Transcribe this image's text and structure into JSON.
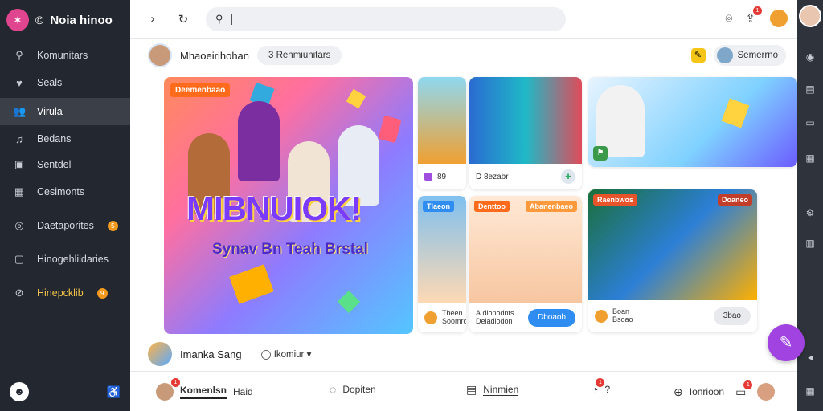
{
  "brand": {
    "name": "Noia hinoo",
    "logo_icon": "star-logo-icon"
  },
  "sidebar": {
    "items": [
      {
        "label": "Komunitars",
        "icon": "person-icon"
      },
      {
        "label": "Seals",
        "icon": "heart-icon"
      },
      {
        "label": "Virula",
        "icon": "people-icon",
        "active": true
      },
      {
        "label": "Bedans",
        "icon": "music-icon"
      },
      {
        "label": "Sentdel",
        "icon": "square-icon"
      },
      {
        "label": "Cesimonts",
        "icon": "grid-icon"
      },
      {
        "label": "Daetaporites",
        "icon": "globe-icon",
        "badge": "5"
      },
      {
        "label": "Hinogehlildaries",
        "icon": "box-icon"
      },
      {
        "label": "Hinepcklib",
        "icon": "compass-icon",
        "badge": "9",
        "highlight": true
      }
    ]
  },
  "topbar": {
    "search_placeholder": "",
    "notif_badge": "1"
  },
  "subheader": {
    "title": "Mhaoeirihohan",
    "pill": "3 Renmiunitars",
    "right_pill": "Semerrno"
  },
  "hero": {
    "tag": "Deemenbaao",
    "title": "MIBNUIOK!",
    "subtitle": "Synav Bn Teah Brstal"
  },
  "cards": [
    {
      "foot_text": "89",
      "foot_text2": "D 8ezabr"
    },
    {
      "tag": "Tlaeon"
    },
    {
      "tag": "Denttoo",
      "foot_text": "Tbeen",
      "foot_text2": "Soomro"
    },
    {
      "tag": "Abanenbaeo",
      "foot_text": "A.dlonodnts",
      "foot_text2": "Deladlodon",
      "button": "Dboaob"
    },
    {
      "tag": "Raenbwos",
      "foot_text": "Boan",
      "foot_text2": "Bsoao",
      "button": "3bao"
    },
    {
      "tag": "Doaneo"
    }
  ],
  "post": {
    "name": "Imanka Sang",
    "comment": "Ikomiur"
  },
  "bottom": {
    "items": [
      {
        "label": "Komenlsn",
        "extra": "Haid",
        "active": true,
        "badge": "1"
      },
      {
        "label": "Dopiten"
      },
      {
        "label": "Ninmien"
      },
      {
        "label": "",
        "extra": "?",
        "badge": "1"
      },
      {
        "label": "Ionrioon",
        "badge": "1"
      }
    ]
  }
}
